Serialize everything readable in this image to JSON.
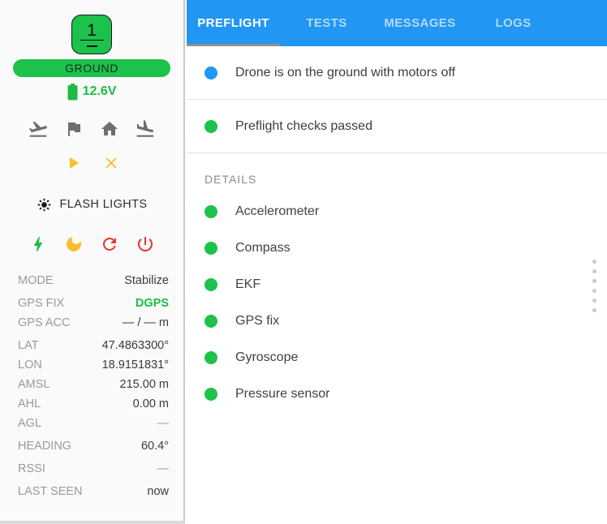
{
  "sidebar": {
    "drone": {
      "id": "1"
    },
    "status_pill": "GROUND",
    "battery": {
      "voltage": "12.6V"
    },
    "nav_icons": [
      "flight-takeoff-icon",
      "flag-icon",
      "home-icon",
      "flight-land-icon"
    ],
    "action_icons": [
      "play-icon",
      "close-icon"
    ],
    "flash_lights_label": "FLASH LIGHTS",
    "power_icons": [
      "lightning-bolt-icon",
      "moon-sleep-icon",
      "refresh-icon",
      "power-icon"
    ],
    "telemetry": [
      {
        "label": "MODE",
        "value": "Stabilize"
      },
      {
        "label": "GPS FIX",
        "value": "DGPS"
      },
      {
        "label": "GPS ACC",
        "value": "— / — m"
      },
      {
        "label": "LAT",
        "value": "47.4863300°"
      },
      {
        "label": "LON",
        "value": "18.9151831°"
      },
      {
        "label": "AMSL",
        "value": "215.00 m"
      },
      {
        "label": "AHL",
        "value": "0.00 m"
      },
      {
        "label": "AGL",
        "value": "—"
      },
      {
        "label": "HEADING",
        "value": "60.4°"
      },
      {
        "label": "RSSI",
        "value": "—"
      },
      {
        "label": "LAST SEEN",
        "value": "now"
      }
    ]
  },
  "panel": {
    "tabs": [
      {
        "label": "PREFLIGHT",
        "active": true
      },
      {
        "label": "TESTS",
        "active": false
      },
      {
        "label": "MESSAGES",
        "active": false
      },
      {
        "label": "LOGS",
        "active": false
      }
    ],
    "statuses": [
      {
        "text": "Drone is on the ground with motors off",
        "dot_color": "#2196f3"
      },
      {
        "text": "Preflight checks passed",
        "dot_color": "#1cc24b"
      }
    ],
    "details_header": "DETAILS",
    "details_items": [
      {
        "text": "Accelerometer",
        "dot_color": "#1cc24b"
      },
      {
        "text": "Compass",
        "dot_color": "#1cc24b"
      },
      {
        "text": "EKF",
        "dot_color": "#1cc24b"
      },
      {
        "text": "GPS fix",
        "dot_color": "#1cc24b"
      },
      {
        "text": "Gyroscope",
        "dot_color": "#1cc24b"
      },
      {
        "text": "Pressure sensor",
        "dot_color": "#1cc24b"
      }
    ]
  },
  "colors": {
    "accent_blue": "#2196f3",
    "success_green": "#1cc24b",
    "battery_green": "#21ba45",
    "warning_amber": "#fbbd2d",
    "danger_red": "#e5372b"
  }
}
